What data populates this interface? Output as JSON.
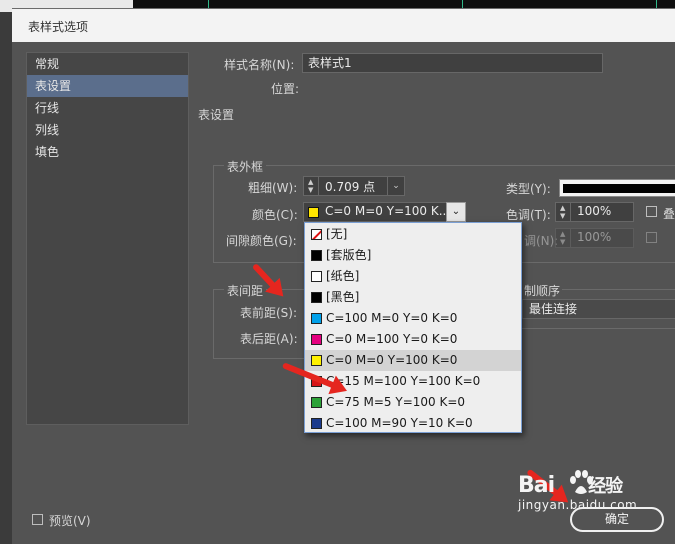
{
  "dialog": {
    "title": "表样式选项"
  },
  "nav": {
    "items": [
      {
        "label": "常规",
        "selected": false
      },
      {
        "label": "表设置",
        "selected": true
      },
      {
        "label": "行线",
        "selected": false
      },
      {
        "label": "列线",
        "selected": false
      },
      {
        "label": "填色",
        "selected": false
      }
    ]
  },
  "style_name": {
    "label": "样式名称(N):",
    "value": "表样式1"
  },
  "location": {
    "label": "位置:"
  },
  "section_heading": "表设置",
  "border": {
    "title": "表外框",
    "weight_label": "粗细(W):",
    "weight_value": "0.709 点",
    "type_label": "类型(Y):",
    "color_label": "颜色(C):",
    "color_value": "C=0 M=0 Y=100 K...",
    "color_swatch": "#ffe500",
    "tint_label": "色调(T):",
    "tint_value": "100%",
    "overprint_label": "叠",
    "gap_color_label": "间隙颜色(G):",
    "gap_tint_label": "调(N):",
    "gap_tint_value": "100%"
  },
  "spacing": {
    "title": "表间距",
    "before_label": "表前距(S):",
    "after_label": "表后距(A):"
  },
  "draw_order": {
    "label": "制顺序",
    "value": "最佳连接"
  },
  "color_dropdown": {
    "items": [
      {
        "label": "[无]",
        "swatch": "none",
        "selected": false
      },
      {
        "label": "[套版色]",
        "swatch": "#000000",
        "selected": false
      },
      {
        "label": "[纸色]",
        "swatch": "#ffffff",
        "selected": false
      },
      {
        "label": "[黑色]",
        "swatch": "#000000",
        "selected": false
      },
      {
        "label": "C=100 M=0 Y=0 K=0",
        "swatch": "#00a0e9",
        "selected": false
      },
      {
        "label": "C=0 M=100 Y=0 K=0",
        "swatch": "#e4007f",
        "selected": false
      },
      {
        "label": "C=0 M=0 Y=100 K=0",
        "swatch": "#fff100",
        "selected": true
      },
      {
        "label": "C=15 M=100 Y=100 K=0",
        "swatch": "#d71518",
        "selected": false
      },
      {
        "label": "C=75 M=5 Y=100 K=0",
        "swatch": "#2ca238",
        "selected": false
      },
      {
        "label": "C=100 M=90 Y=10 K=0",
        "swatch": "#1b3a8c",
        "selected": false
      }
    ]
  },
  "preview": {
    "label": "预览(V)"
  },
  "ok_button": {
    "label": "确定"
  },
  "watermark": {
    "brand": "Bai",
    "brand2": "经验",
    "url": "jingyan.baidu.com"
  },
  "colors": {
    "accent": "#e5261f",
    "selection": "#5b6e8c"
  }
}
